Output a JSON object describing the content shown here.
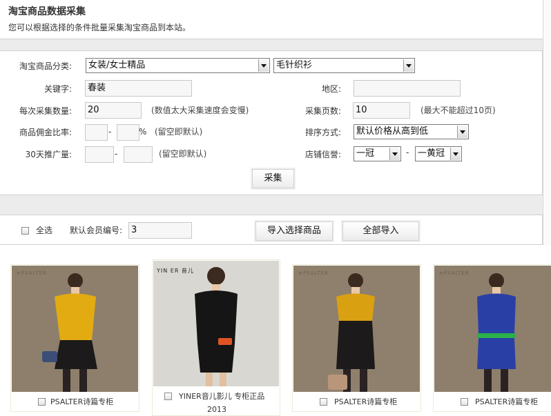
{
  "header": {
    "title": "淘宝商品数据采集",
    "description": "您可以根据选择的条件批量采集淘宝商品到本站。"
  },
  "form": {
    "category_label": "淘宝商品分类:",
    "category_primary": "女装/女士精品",
    "category_secondary": "毛针织衫",
    "keyword_label": "关键字:",
    "keyword_value": "春装",
    "region_label": "地区:",
    "region_value": "",
    "per_count_label": "每次采集数量:",
    "per_count_value": "20",
    "per_count_hint": "(数值太大采集速度会变慢)",
    "pages_label": "采集页数:",
    "pages_value": "10",
    "pages_hint": "(最大不能超过10页)",
    "commission_label": "商品佣金比率:",
    "commission_min": "",
    "commission_max": "",
    "percent_sign": "%",
    "commission_hint": "(留空即默认)",
    "sort_label": "排序方式:",
    "sort_value": "默认价格从高到低",
    "promo_label": "30天推广量:",
    "promo_min": "",
    "promo_max": "",
    "promo_hint": "(留空即默认)",
    "credit_label": "店铺信誉:",
    "credit_min": "一冠",
    "credit_max": "一黄冠",
    "range_dash": "-",
    "collect_button": "采集"
  },
  "actions": {
    "select_all_label": "全选",
    "member_id_label": "默认会员编号:",
    "member_id_value": "3",
    "import_selected_button": "导入选择商品",
    "import_all_button": "全部导入"
  },
  "products": [
    {
      "brand_mark": "≡PSALTER",
      "title": "PSALTER诗篇专柜",
      "subtitle": "",
      "colors": {
        "bg": "#8e7f6c",
        "top": "#e2ab12",
        "bottom": "#1c1a1a"
      }
    },
    {
      "brand_mark": "YIN ER 音儿",
      "title": "YINER音儿影儿 专柜正品",
      "subtitle": "2013",
      "colors": {
        "bg": "#d9d7d2",
        "top": "#161515",
        "bottom": "#161515"
      }
    },
    {
      "brand_mark": "≡PSALTER",
      "title": "PSALTER诗篇专柜",
      "subtitle": "",
      "colors": {
        "bg": "#8f806d",
        "top": "#d9a012",
        "bottom": "#1c1a1a"
      }
    },
    {
      "brand_mark": "≡PSALTER",
      "title": "PSALTER诗篇专柜",
      "subtitle": "",
      "colors": {
        "bg": "#8e7f6c",
        "top": "#2a3fa6",
        "bottom": "#2a3fa6"
      }
    }
  ]
}
